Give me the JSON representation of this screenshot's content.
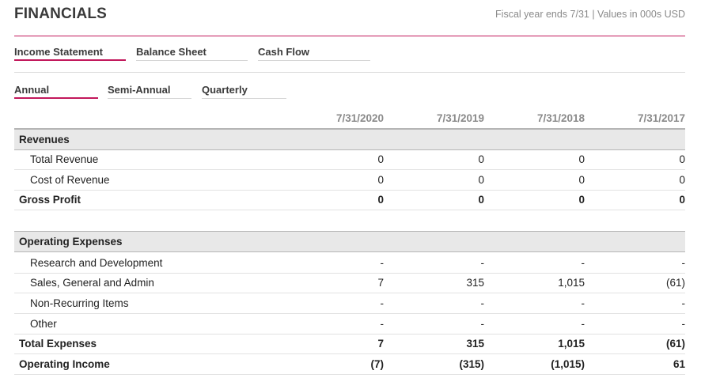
{
  "header": {
    "title": "FINANCIALS",
    "note": "Fiscal year ends 7/31 | Values in 000s USD"
  },
  "statement_tabs": [
    {
      "label": "Income Statement",
      "active": true
    },
    {
      "label": "Balance Sheet",
      "active": false
    },
    {
      "label": "Cash Flow",
      "active": false
    }
  ],
  "period_tabs": [
    {
      "label": "Annual",
      "active": true
    },
    {
      "label": "Semi-Annual",
      "active": false
    },
    {
      "label": "Quarterly",
      "active": false
    }
  ],
  "columns": [
    "7/31/2020",
    "7/31/2019",
    "7/31/2018",
    "7/31/2017"
  ],
  "rows": [
    {
      "label": "Revenues",
      "kind": "section",
      "values": []
    },
    {
      "label": "Total Revenue",
      "kind": "sub",
      "values": [
        "0",
        "0",
        "0",
        "0"
      ]
    },
    {
      "label": "Cost of Revenue",
      "kind": "sub",
      "values": [
        "0",
        "0",
        "0",
        "0"
      ]
    },
    {
      "label": "Gross Profit",
      "kind": "bold",
      "values": [
        "0",
        "0",
        "0",
        "0"
      ]
    },
    {
      "label": "",
      "kind": "spacer",
      "values": []
    },
    {
      "label": "Operating Expenses",
      "kind": "section",
      "values": []
    },
    {
      "label": "Research and Development",
      "kind": "sub",
      "values": [
        "-",
        "-",
        "-",
        "-"
      ]
    },
    {
      "label": "Sales, General and Admin",
      "kind": "sub",
      "values": [
        "7",
        "315",
        "1,015",
        "(61)"
      ]
    },
    {
      "label": "Non-Recurring Items",
      "kind": "sub",
      "values": [
        "-",
        "-",
        "-",
        "-"
      ]
    },
    {
      "label": "Other",
      "kind": "sub",
      "values": [
        "-",
        "-",
        "-",
        "-"
      ]
    },
    {
      "label": "Total Expenses",
      "kind": "bold",
      "values": [
        "7",
        "315",
        "1,015",
        "(61)"
      ]
    },
    {
      "label": "Operating Income",
      "kind": "bold",
      "values": [
        "(7)",
        "(315)",
        "(1,015)",
        "61"
      ]
    }
  ]
}
